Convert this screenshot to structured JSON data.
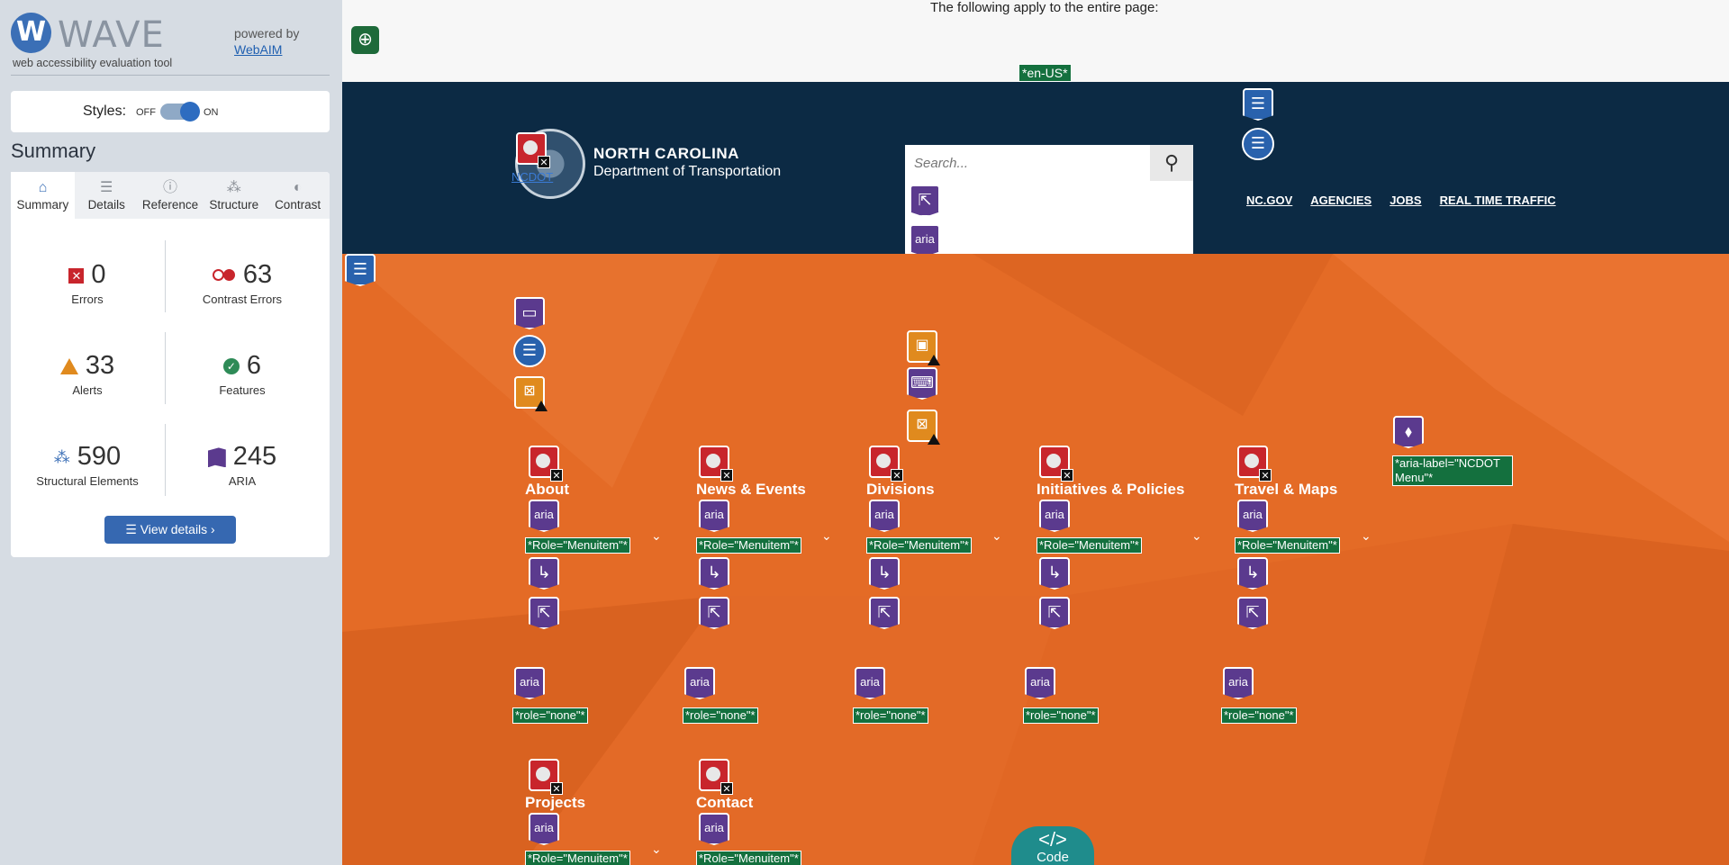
{
  "wave": {
    "logo_letter": "W",
    "title": "WAVE",
    "tagline": "web accessibility evaluation tool",
    "powered_by": "powered by",
    "webaim_link": "WebAIM",
    "styles_label": "Styles:",
    "styles_off": "OFF",
    "styles_on": "ON",
    "summary_heading": "Summary",
    "tabs": [
      {
        "label": "Summary",
        "icon": "home-icon"
      },
      {
        "label": "Details",
        "icon": "list-icon"
      },
      {
        "label": "Reference",
        "icon": "info-icon"
      },
      {
        "label": "Structure",
        "icon": "hierarchy-icon"
      },
      {
        "label": "Contrast",
        "icon": "contrast-icon"
      }
    ],
    "stats": {
      "errors": {
        "value": "0",
        "label": "Errors"
      },
      "contrast_errors": {
        "value": "63",
        "label": "Contrast Errors"
      },
      "alerts": {
        "value": "33",
        "label": "Alerts"
      },
      "features": {
        "value": "6",
        "label": "Features"
      },
      "structural": {
        "value": "590",
        "label": "Structural Elements"
      },
      "aria": {
        "value": "245",
        "label": "ARIA"
      }
    },
    "view_details": "View details ›"
  },
  "page": {
    "note": "The following apply to the entire page:",
    "lang_tag": "*en-US*",
    "brand_line1": "NORTH CAROLINA",
    "brand_line2": "Department of Transportation",
    "brand_link": "NCDOT",
    "search_placeholder": "Search...",
    "util_nav": [
      "NC.GOV",
      "AGENCIES",
      "JOBS",
      "REAL TIME TRAFFIC"
    ],
    "aria_label_tag": "*aria-label=\"NCDOT Menu\"*",
    "menu_items": [
      "About",
      "News & Events",
      "Divisions",
      "Initiatives & Policies",
      "Travel & Maps",
      "Projects",
      "Contact"
    ],
    "role_menuitem": "*Role=\"Menuitem\"*",
    "role_none": "*role=\"none\"*",
    "aria_icon_text": "aria",
    "code_tab_symbol": "</>",
    "code_tab_label": "Code"
  },
  "colors": {
    "navy": "#0c2a44",
    "orange": "#e46b26",
    "wave_blue": "#3668b1",
    "error_red": "#c8252c",
    "aria_purple": "#5b3a8e",
    "tag_green": "#14703e"
  }
}
